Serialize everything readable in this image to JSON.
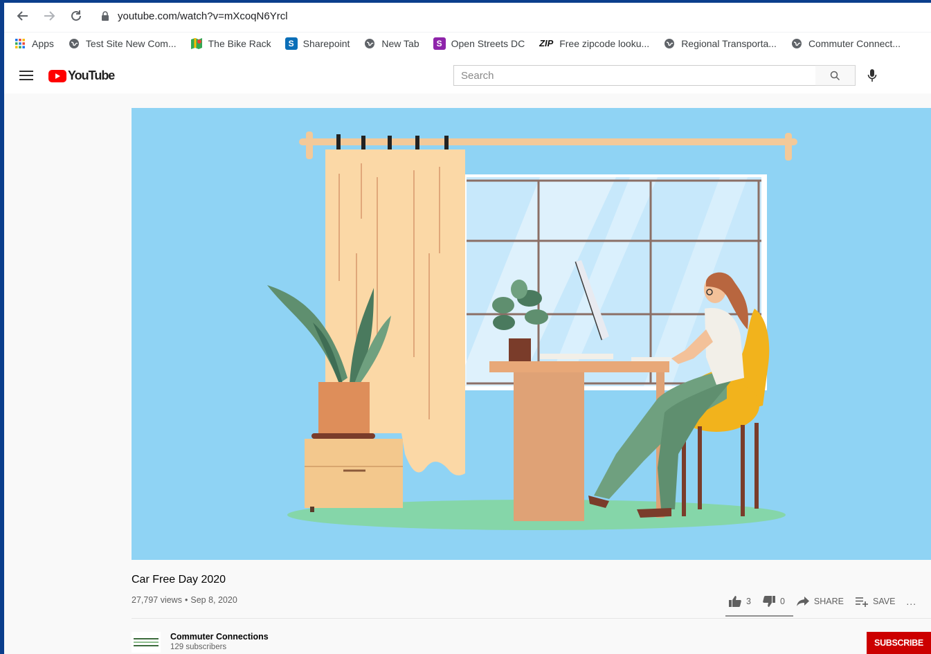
{
  "browser": {
    "url": "youtube.com/watch?v=mXcoqN6Yrcl",
    "bookmarks": [
      {
        "label": "Apps",
        "icon": "apps-grid-icon"
      },
      {
        "label": "Test Site New Com...",
        "icon": "globe-icon"
      },
      {
        "label": "The Bike Rack",
        "icon": "maps-icon"
      },
      {
        "label": "Sharepoint",
        "icon": "sharepoint-icon"
      },
      {
        "label": "New Tab",
        "icon": "globe-icon"
      },
      {
        "label": "Open Streets DC",
        "icon": "s-logo-icon"
      },
      {
        "label": "Free zipcode looku...",
        "icon": "zip-logo-icon"
      },
      {
        "label": "Regional Transporta...",
        "icon": "globe-icon"
      },
      {
        "label": "Commuter Connect...",
        "icon": "globe-icon"
      }
    ]
  },
  "youtube": {
    "logo_text": "YouTube",
    "search_placeholder": "Search",
    "video": {
      "title": "Car Free Day 2020",
      "views": "27,797 views",
      "separator": "•",
      "date": "Sep 8, 2020",
      "likes": "3",
      "dislikes": "0",
      "share_label": "SHARE",
      "save_label": "SAVE",
      "more_label": "..."
    },
    "channel": {
      "name": "Commuter Connections",
      "subscribers": "129 subscribers",
      "subscribe_label": "SUBSCRIBE"
    }
  },
  "colors": {
    "accent": "#cc0000",
    "video_bg": "#8fd3f4",
    "frame": "#0b3e8c"
  }
}
